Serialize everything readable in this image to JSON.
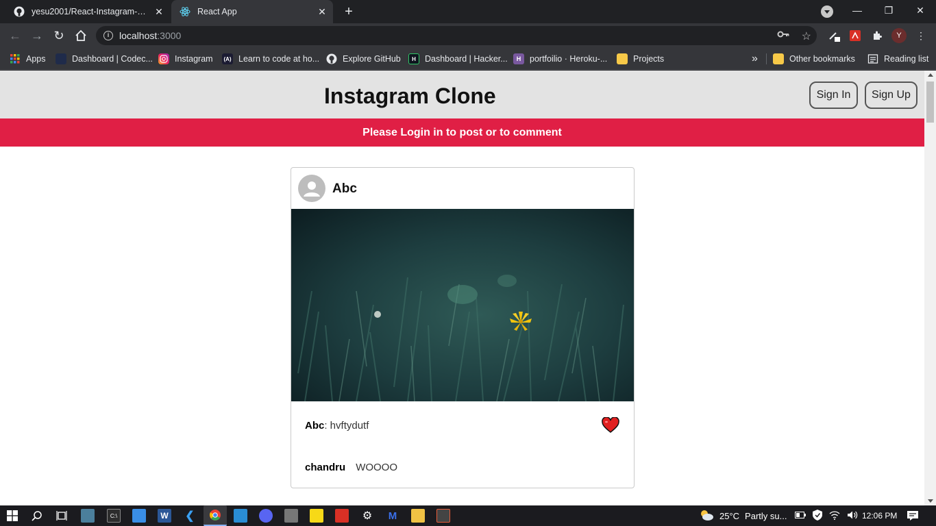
{
  "browser": {
    "tabs": [
      {
        "title": "yesu2001/React-Instagram-Clone",
        "icon": "github-icon",
        "active": false
      },
      {
        "title": "React App",
        "icon": "react-icon",
        "active": true
      }
    ],
    "url_host": "localhost",
    "url_port": ":3000",
    "profile_initial": "Y",
    "bookmarks": [
      {
        "label": "Apps",
        "icon": "apps-grid-icon"
      },
      {
        "label": "Dashboard | Codec...",
        "icon": "codecademy-icon"
      },
      {
        "label": "Instagram",
        "icon": "instagram-icon"
      },
      {
        "label": "Learn to code at ho...",
        "icon": "freecodecamp-icon"
      },
      {
        "label": "Explore GitHub",
        "icon": "github-icon"
      },
      {
        "label": "Dashboard | Hacker...",
        "icon": "hackerrank-icon"
      },
      {
        "label": "portfoilio · Heroku-...",
        "icon": "heroku-icon"
      },
      {
        "label": "Projects",
        "icon": "folder-icon"
      },
      {
        "label": "Other bookmarks",
        "icon": "folder-icon"
      },
      {
        "label": "Reading list",
        "icon": "reading-list-icon"
      }
    ],
    "overflow_label": "»"
  },
  "app": {
    "title": "Instagram Clone",
    "sign_in": "Sign In",
    "sign_up": "Sign Up",
    "banner": "Please Login in to post or to comment",
    "colors": {
      "banner": "#e01f45",
      "header": "#e3e3e3"
    }
  },
  "post": {
    "username": "Abc",
    "caption_user": "Abc",
    "caption_text": ": hvftydutf",
    "liked": true,
    "comments": [
      {
        "user": "chandru",
        "text": "WOOOO"
      }
    ]
  },
  "taskbar": {
    "temperature": "25°C",
    "weather": "Partly su...",
    "time": "12:06 PM"
  }
}
